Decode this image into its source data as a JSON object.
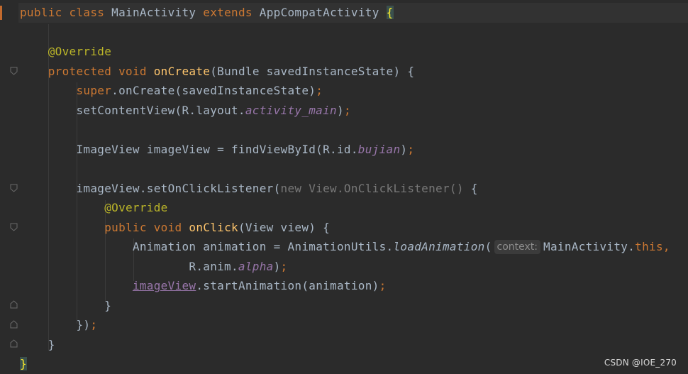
{
  "editor": {
    "language": "Java",
    "colors": {
      "background": "#2b2b2b",
      "keyword": "#cc7832",
      "function": "#ffc66d",
      "annotation": "#bbb529",
      "field": "#9876aa",
      "text": "#a9b7c6",
      "muted": "#787878",
      "brace_highlight": "#ffef28"
    }
  },
  "code": {
    "l1": {
      "kw1": "public",
      "kw2": "class",
      "name": "MainActivity",
      "kw3": "extends",
      "parent": "AppCompatActivity",
      "brace": "{"
    },
    "l3": {
      "annotation": "@Override"
    },
    "l4": {
      "kw1": "protected",
      "kw2": "void",
      "method": "onCreate",
      "params": "(Bundle savedInstanceState) {"
    },
    "l5": {
      "kw": "super",
      "rest": ".onCreate(savedInstanceState)",
      "semi": ";"
    },
    "l6": {
      "pre": "setContentView(R.layout.",
      "field": "activity_main",
      "post": ")",
      "semi": ";"
    },
    "l8": {
      "pre": "ImageView imageView = findViewById(R.id.",
      "field": "bujian",
      "post": ")",
      "semi": ";"
    },
    "l10": {
      "pre": "imageView.setOnClickListener(",
      "muted": "new View.OnClickListener()",
      "post": " {"
    },
    "l11": {
      "annotation": "@Override"
    },
    "l12": {
      "kw1": "public",
      "kw2": "void",
      "method": "onClick",
      "params": "(View view) {"
    },
    "l13": {
      "pre": "Animation animation = AnimationUtils.",
      "call": "loadAnimation",
      "paren": "(",
      "hint": "context:",
      "arg": "MainActivity.",
      "kw": "this",
      "comma": ","
    },
    "l14": {
      "pre": "R.anim.",
      "field": "alpha",
      "post": ")",
      "semi": ";"
    },
    "l15": {
      "var": "imageView",
      "rest": ".startAnimation(animation)",
      "semi": ";"
    },
    "l16": {
      "text": "}"
    },
    "l17": {
      "text": "})",
      "semi": ";"
    },
    "l18": {
      "text": "}"
    },
    "l19": {
      "brace": "}"
    }
  },
  "watermark": "CSDN @IOE_270"
}
